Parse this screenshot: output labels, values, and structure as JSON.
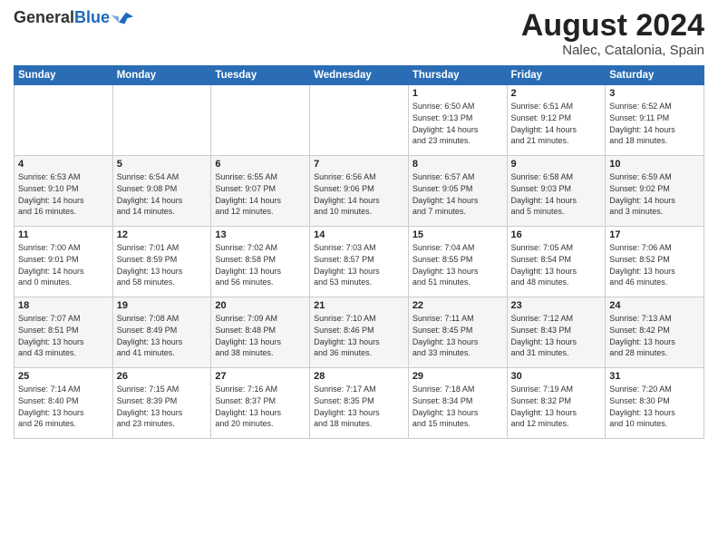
{
  "header": {
    "logo_general": "General",
    "logo_blue": "Blue",
    "month_title": "August 2024",
    "location": "Nalec, Catalonia, Spain"
  },
  "days_of_week": [
    "Sunday",
    "Monday",
    "Tuesday",
    "Wednesday",
    "Thursday",
    "Friday",
    "Saturday"
  ],
  "weeks": [
    [
      {
        "day": "",
        "info": ""
      },
      {
        "day": "",
        "info": ""
      },
      {
        "day": "",
        "info": ""
      },
      {
        "day": "",
        "info": ""
      },
      {
        "day": "1",
        "info": "Sunrise: 6:50 AM\nSunset: 9:13 PM\nDaylight: 14 hours\nand 23 minutes."
      },
      {
        "day": "2",
        "info": "Sunrise: 6:51 AM\nSunset: 9:12 PM\nDaylight: 14 hours\nand 21 minutes."
      },
      {
        "day": "3",
        "info": "Sunrise: 6:52 AM\nSunset: 9:11 PM\nDaylight: 14 hours\nand 18 minutes."
      }
    ],
    [
      {
        "day": "4",
        "info": "Sunrise: 6:53 AM\nSunset: 9:10 PM\nDaylight: 14 hours\nand 16 minutes."
      },
      {
        "day": "5",
        "info": "Sunrise: 6:54 AM\nSunset: 9:08 PM\nDaylight: 14 hours\nand 14 minutes."
      },
      {
        "day": "6",
        "info": "Sunrise: 6:55 AM\nSunset: 9:07 PM\nDaylight: 14 hours\nand 12 minutes."
      },
      {
        "day": "7",
        "info": "Sunrise: 6:56 AM\nSunset: 9:06 PM\nDaylight: 14 hours\nand 10 minutes."
      },
      {
        "day": "8",
        "info": "Sunrise: 6:57 AM\nSunset: 9:05 PM\nDaylight: 14 hours\nand 7 minutes."
      },
      {
        "day": "9",
        "info": "Sunrise: 6:58 AM\nSunset: 9:03 PM\nDaylight: 14 hours\nand 5 minutes."
      },
      {
        "day": "10",
        "info": "Sunrise: 6:59 AM\nSunset: 9:02 PM\nDaylight: 14 hours\nand 3 minutes."
      }
    ],
    [
      {
        "day": "11",
        "info": "Sunrise: 7:00 AM\nSunset: 9:01 PM\nDaylight: 14 hours\nand 0 minutes."
      },
      {
        "day": "12",
        "info": "Sunrise: 7:01 AM\nSunset: 8:59 PM\nDaylight: 13 hours\nand 58 minutes."
      },
      {
        "day": "13",
        "info": "Sunrise: 7:02 AM\nSunset: 8:58 PM\nDaylight: 13 hours\nand 56 minutes."
      },
      {
        "day": "14",
        "info": "Sunrise: 7:03 AM\nSunset: 8:57 PM\nDaylight: 13 hours\nand 53 minutes."
      },
      {
        "day": "15",
        "info": "Sunrise: 7:04 AM\nSunset: 8:55 PM\nDaylight: 13 hours\nand 51 minutes."
      },
      {
        "day": "16",
        "info": "Sunrise: 7:05 AM\nSunset: 8:54 PM\nDaylight: 13 hours\nand 48 minutes."
      },
      {
        "day": "17",
        "info": "Sunrise: 7:06 AM\nSunset: 8:52 PM\nDaylight: 13 hours\nand 46 minutes."
      }
    ],
    [
      {
        "day": "18",
        "info": "Sunrise: 7:07 AM\nSunset: 8:51 PM\nDaylight: 13 hours\nand 43 minutes."
      },
      {
        "day": "19",
        "info": "Sunrise: 7:08 AM\nSunset: 8:49 PM\nDaylight: 13 hours\nand 41 minutes."
      },
      {
        "day": "20",
        "info": "Sunrise: 7:09 AM\nSunset: 8:48 PM\nDaylight: 13 hours\nand 38 minutes."
      },
      {
        "day": "21",
        "info": "Sunrise: 7:10 AM\nSunset: 8:46 PM\nDaylight: 13 hours\nand 36 minutes."
      },
      {
        "day": "22",
        "info": "Sunrise: 7:11 AM\nSunset: 8:45 PM\nDaylight: 13 hours\nand 33 minutes."
      },
      {
        "day": "23",
        "info": "Sunrise: 7:12 AM\nSunset: 8:43 PM\nDaylight: 13 hours\nand 31 minutes."
      },
      {
        "day": "24",
        "info": "Sunrise: 7:13 AM\nSunset: 8:42 PM\nDaylight: 13 hours\nand 28 minutes."
      }
    ],
    [
      {
        "day": "25",
        "info": "Sunrise: 7:14 AM\nSunset: 8:40 PM\nDaylight: 13 hours\nand 26 minutes."
      },
      {
        "day": "26",
        "info": "Sunrise: 7:15 AM\nSunset: 8:39 PM\nDaylight: 13 hours\nand 23 minutes."
      },
      {
        "day": "27",
        "info": "Sunrise: 7:16 AM\nSunset: 8:37 PM\nDaylight: 13 hours\nand 20 minutes."
      },
      {
        "day": "28",
        "info": "Sunrise: 7:17 AM\nSunset: 8:35 PM\nDaylight: 13 hours\nand 18 minutes."
      },
      {
        "day": "29",
        "info": "Sunrise: 7:18 AM\nSunset: 8:34 PM\nDaylight: 13 hours\nand 15 minutes."
      },
      {
        "day": "30",
        "info": "Sunrise: 7:19 AM\nSunset: 8:32 PM\nDaylight: 13 hours\nand 12 minutes."
      },
      {
        "day": "31",
        "info": "Sunrise: 7:20 AM\nSunset: 8:30 PM\nDaylight: 13 hours\nand 10 minutes."
      }
    ]
  ]
}
